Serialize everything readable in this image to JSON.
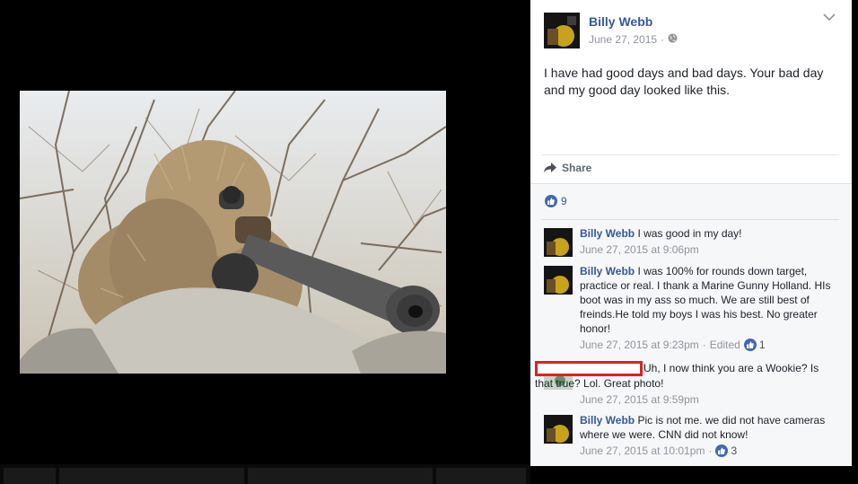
{
  "post": {
    "author": "Billy Webb",
    "date": "June 27, 2015",
    "separator": "·",
    "privacy_icon": "globe-icon",
    "text": "I have had good days and bad days. Your bad day and my good day looked like this.",
    "share_label": "Share",
    "like_count": "9"
  },
  "comments": [
    {
      "author": "Billy Webb",
      "text": " I was good in my day!",
      "time": "June 27, 2015 at 9:06pm"
    },
    {
      "author": "Billy Webb",
      "text": " I was 100% for rounds down target, practice or real. I thank a Marine Gunny Holland. HIs boot was in my ass so much. We are still best of freinds.He told my boys I was his best. No greater honor!",
      "time": "June 27, 2015 at 9:23pm",
      "edited": "Edited",
      "reactions": "1"
    },
    {
      "author": "",
      "text": "Uh, I now think you are a Wookie? Is that true? Lol. Great photo!",
      "time": "June 27, 2015 at 9:59pm"
    },
    {
      "author": "Billy Webb",
      "text": " Pic is not me. we did not have cameras where we were. CNN did not know!",
      "time": "June 27, 2015 at 10:01pm",
      "reactions": "3"
    }
  ],
  "colors": {
    "link": "#365899",
    "like_blue": "#4267b2",
    "redaction": "#e02020"
  }
}
